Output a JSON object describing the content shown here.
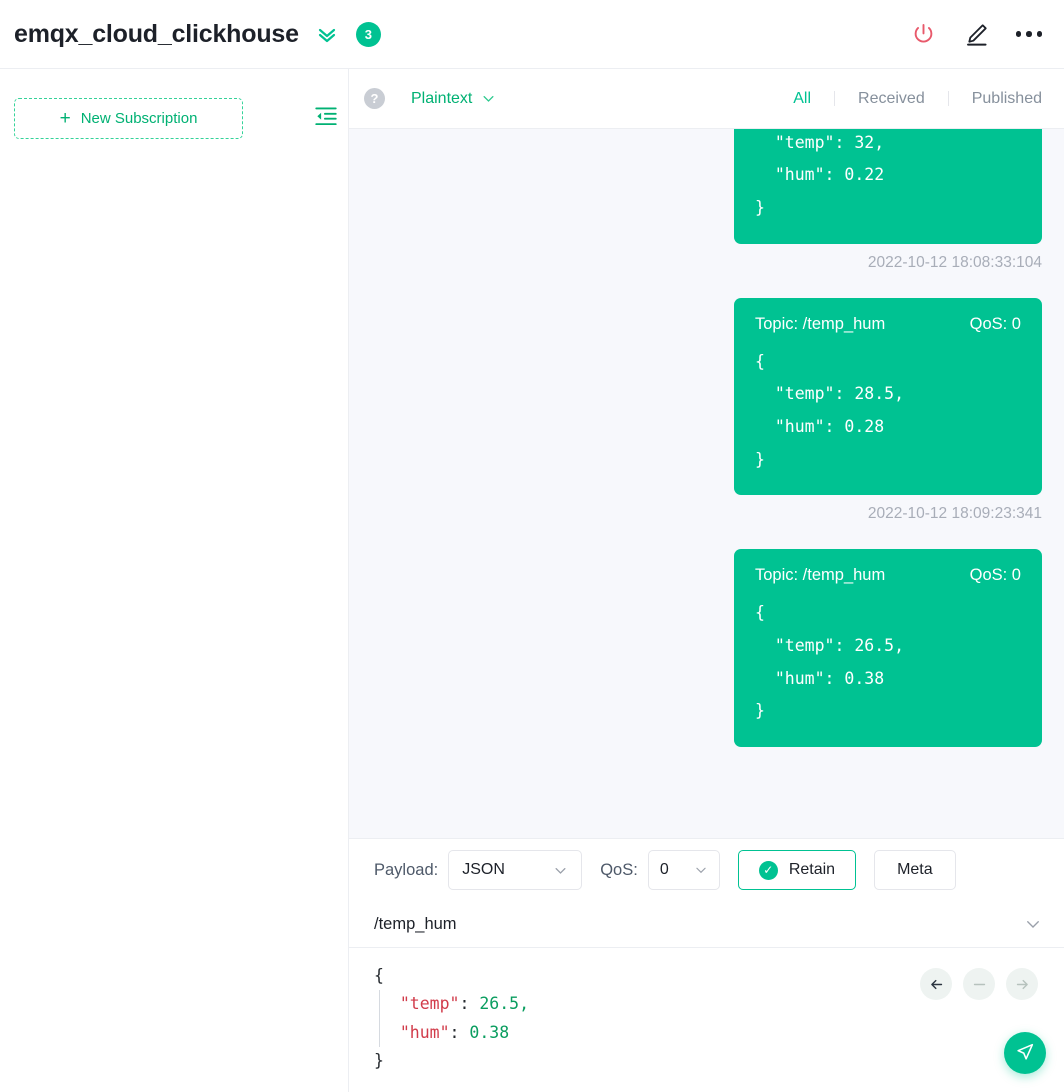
{
  "topbar": {
    "title": "emqx_cloud_clickhouse",
    "expand_icon": "double-chevron-down-icon",
    "badge_count": "3",
    "actions": [
      {
        "name": "power-icon",
        "label": ""
      },
      {
        "name": "edit-pencil-icon",
        "label": ""
      },
      {
        "name": "more-options-icon",
        "label": ""
      }
    ]
  },
  "sidebar": {
    "new_subscription_label": "New Subscription",
    "plus": "+",
    "collapse_icon": "collapse-panel-icon"
  },
  "msg_toolbar": {
    "help_icon_label": "?",
    "format": "Plaintext",
    "tabs": [
      {
        "label": "All",
        "active": true
      },
      {
        "label": "Received",
        "active": false
      },
      {
        "label": "Published",
        "active": false
      }
    ]
  },
  "messages": [
    {
      "topic_label": "",
      "qos_label": "",
      "payload": "{\n  \"temp\": 32,\n  \"hum\": 0.22\n}",
      "timestamp": "2022-10-12 18:08:33:104"
    },
    {
      "topic_label": "Topic: /temp_hum",
      "qos_label": "QoS: 0",
      "payload": "{\n  \"temp\": 28.5,\n  \"hum\": 0.28\n}",
      "timestamp": "2022-10-12 18:09:23:341"
    },
    {
      "topic_label": "Topic: /temp_hum",
      "qos_label": "QoS: 0",
      "payload": "{\n  \"temp\": 26.5,\n  \"hum\": 0.38\n}",
      "timestamp": ""
    }
  ],
  "publish": {
    "payload_label": "Payload:",
    "payload_value": "JSON",
    "qos_label": "QoS:",
    "qos_value": "0",
    "retain_label": "Retain",
    "retain_checked": true,
    "meta_label": "Meta",
    "topic_value": "/temp_hum",
    "editor": {
      "line1": "{",
      "line2_key": "\"temp\"",
      "line2_colon": ": ",
      "line2_val": "26.5,",
      "line3_key": "\"hum\"",
      "line3_colon": ": ",
      "line3_val": "0.38",
      "line4": "}"
    },
    "nav": {
      "back_icon": "arrow-left-icon",
      "collapse_icon": "minus-icon",
      "forward_icon": "arrow-right-icon"
    },
    "send_icon": "send-paper-plane-icon"
  },
  "colors": {
    "brand_green": "#00c292",
    "power_red": "#e8596b",
    "muted_gray": "#86909c",
    "panel_bg": "#f7f8fc",
    "json_key_red": "#d13b4a",
    "json_num_green": "#0a9d5f"
  }
}
